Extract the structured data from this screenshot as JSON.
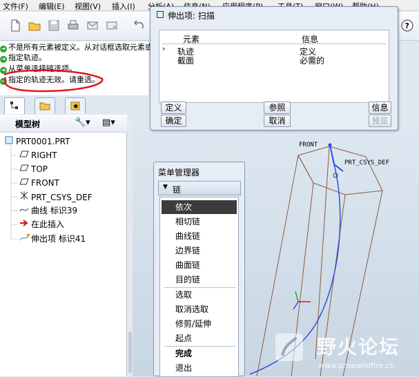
{
  "menubar": {
    "items": [
      "文件(F)",
      "编辑(E)",
      "视图(V)",
      "插入(I)",
      "分析(A)",
      "信息(N)",
      "应用程序(P)",
      "工具(T)",
      "窗口(W)",
      "帮助(H)"
    ]
  },
  "messages": [
    "不是所有元素被定义。从对话框选取元素或",
    "指定轨迹。",
    "从菜单选择链选项。",
    "指定的轨迹无效。请重选。"
  ],
  "tree": {
    "title": "模型树",
    "items": [
      {
        "label": "PRT0001.PRT",
        "icon": "part-icon"
      },
      {
        "label": "RIGHT",
        "icon": "datum-plane-icon"
      },
      {
        "label": "TOP",
        "icon": "datum-plane-icon"
      },
      {
        "label": "FRONT",
        "icon": "datum-plane-icon"
      },
      {
        "label": "PRT_CSYS_DEF",
        "icon": "csys-icon"
      },
      {
        "label": "曲线 标识39",
        "icon": "curve-icon"
      },
      {
        "label": "在此插入",
        "icon": "insert-here-arrow-icon"
      },
      {
        "label": "伸出项 标识41",
        "icon": "sweep-feature-icon"
      }
    ]
  },
  "dialog": {
    "title": "伸出项: 扫描",
    "col_element": "元素",
    "col_info": "信息",
    "rows": [
      {
        "element": "轨迹",
        "info": "定义",
        "current": true
      },
      {
        "element": "截面",
        "info": "必需的",
        "current": false
      }
    ],
    "btn_define": "定义",
    "btn_reference": "参照",
    "btn_info": "信息",
    "btn_ok": "确定",
    "btn_cancel": "取消",
    "btn_preview": "预览"
  },
  "menu_manager": {
    "title": "菜单管理器",
    "section": "链",
    "items": [
      "依次",
      "相切链",
      "曲线链",
      "边界链",
      "曲面链",
      "目的链"
    ],
    "items2": [
      "选取",
      "取消选取",
      "修剪/延伸",
      "起点"
    ],
    "items3": [
      "完成",
      "退出"
    ]
  },
  "graphics": {
    "label_front": "FRONT",
    "label_csys": "PRT_CSYS_DEF"
  },
  "watermark": {
    "title": "野火论坛",
    "url": "www.proewildfire.cn"
  },
  "colors": {
    "accent": "#2d5a8c",
    "message_arrow": "#29a329",
    "annotation_red": "#e0141e",
    "model_lines": "#8c5a3c"
  }
}
